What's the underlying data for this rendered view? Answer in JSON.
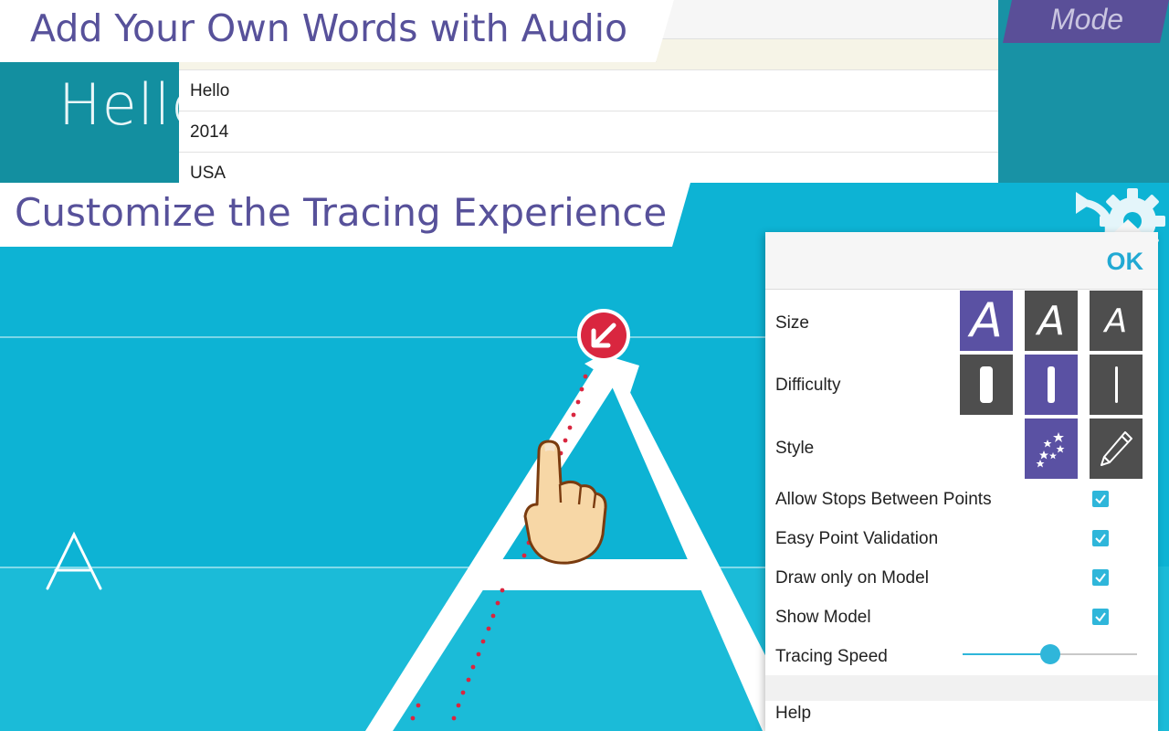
{
  "top_section": {
    "banner_title": "Add Your Own Words with Audio",
    "mode_label": "Mode",
    "word_preview": "Hello",
    "word_list": [
      "Hello",
      "2014",
      "USA"
    ]
  },
  "tracing_section": {
    "banner_title": "Customize the Tracing Experience",
    "model_letter": "A",
    "toolbar_icons": [
      "reset-icon",
      "gear-icon"
    ]
  },
  "settings": {
    "ok_label": "OK",
    "size_label": "Size",
    "difficulty_label": "Difficulty",
    "style_label": "Style",
    "size_options": [
      "A",
      "A",
      "A"
    ],
    "size_selected_index": 0,
    "difficulty_selected_index": 1,
    "style_options": [
      "stars-icon",
      "pencil-icon"
    ],
    "style_selected_index": 0,
    "toggles": [
      {
        "label": "Allow Stops Between Points",
        "checked": true
      },
      {
        "label": "Easy Point Validation",
        "checked": true
      },
      {
        "label": "Draw only on Model",
        "checked": true
      },
      {
        "label": "Show Model",
        "checked": true
      }
    ],
    "tracing_speed_label": "Tracing Speed",
    "tracing_speed_value": 0.5,
    "help_label": "Help"
  },
  "colors": {
    "accent_purple": "#5a51a3",
    "accent_blue": "#2fb6da",
    "tracing_bg": "#0db3d4",
    "start_marker": "#d9263f"
  }
}
